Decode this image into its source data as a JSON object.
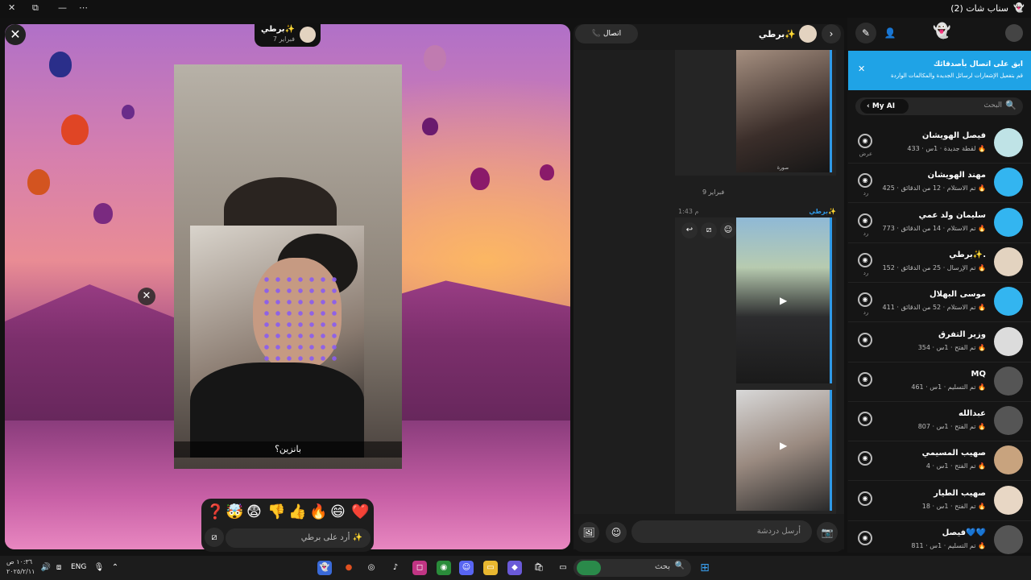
{
  "window": {
    "title": "(2) سناب شات",
    "controls": [
      "⤢",
      "—",
      "⋯",
      "✕"
    ]
  },
  "viewer": {
    "sender_name": "برطي✨",
    "sender_date": "7 فبراير",
    "caption": "بانزين؟",
    "reply_placeholder": "أرد على برطي ✨",
    "reactions": [
      "❤️",
      "😄",
      "🔥",
      "👍",
      "👎",
      "😨",
      "🤯",
      "❓"
    ]
  },
  "chat": {
    "contact": "برطي✨",
    "call_label": "اتصال",
    "time_label": "1:43 م",
    "date_label": "9 فبراير",
    "sender_tag": "برطي✨",
    "thumb_caption": "صورة",
    "composer_placeholder": "أرسل دردشة"
  },
  "sidebar": {
    "banner_title": "ابق على اتصال بأصدقائك",
    "banner_text": "قم بتفعيل الإشعارات لرسائل الجديدة والمكالمات الواردة",
    "search_placeholder": "البحث",
    "my_ai": "My AI",
    "rows": [
      {
        "name": "فيصل الهويشان",
        "meta": "لقطة جديدة · 1س · 433 🔥",
        "under": "عرض",
        "avatar": "#bfe3e6"
      },
      {
        "name": "مهند الهويشان",
        "meta": "تم الاستلام · 12 من الدقائق · 425 🔥",
        "under": "رد",
        "avatar": "#33b5f0"
      },
      {
        "name": "سليمان ولد عمي",
        "meta": "تم الاستلام · 14 من الدقائق · 773 🔥",
        "under": "رد",
        "avatar": "#33b5f0"
      },
      {
        "name": "برطي✨.",
        "meta": "تم الإرسال · 25 من الدقائق · 152 🔥",
        "under": "رد",
        "avatar": "#e3d3c0"
      },
      {
        "name": "موسى البهلال",
        "meta": "تم الاستلام · 52 من الدقائق · 411 🔥",
        "under": "رد",
        "avatar": "#33b5f0"
      },
      {
        "name": "وزير التفرق",
        "meta": "تم الفتح · 1س · 354 🔥",
        "under": "",
        "avatar": "#dcdcdc"
      },
      {
        "name": "MQ",
        "meta": "تم التسليم · 1س · 461 🔥",
        "under": "",
        "avatar": "#555"
      },
      {
        "name": "عبدالله",
        "meta": "تم الفتح · 1س · 807 🔥",
        "under": "",
        "avatar": "#555"
      },
      {
        "name": "صهيب المسيمي",
        "meta": "تم الفتح · 1س · 4 🔥",
        "under": "",
        "avatar": "#c8a37e"
      },
      {
        "name": "صهيب الطيار",
        "meta": "تم الفتح · 1س · 18 🔥",
        "under": "",
        "avatar": "#e8d7c5"
      },
      {
        "name": "فيصل💙💙",
        "meta": "تم التسليم · 1س · 811 🔥",
        "under": "",
        "avatar": "#555"
      }
    ]
  },
  "taskbar": {
    "search_placeholder": "بحث",
    "lang": "ENG",
    "time": "١٠:٣٦ ص",
    "date": "٢٠٢٥/٢/١١"
  }
}
